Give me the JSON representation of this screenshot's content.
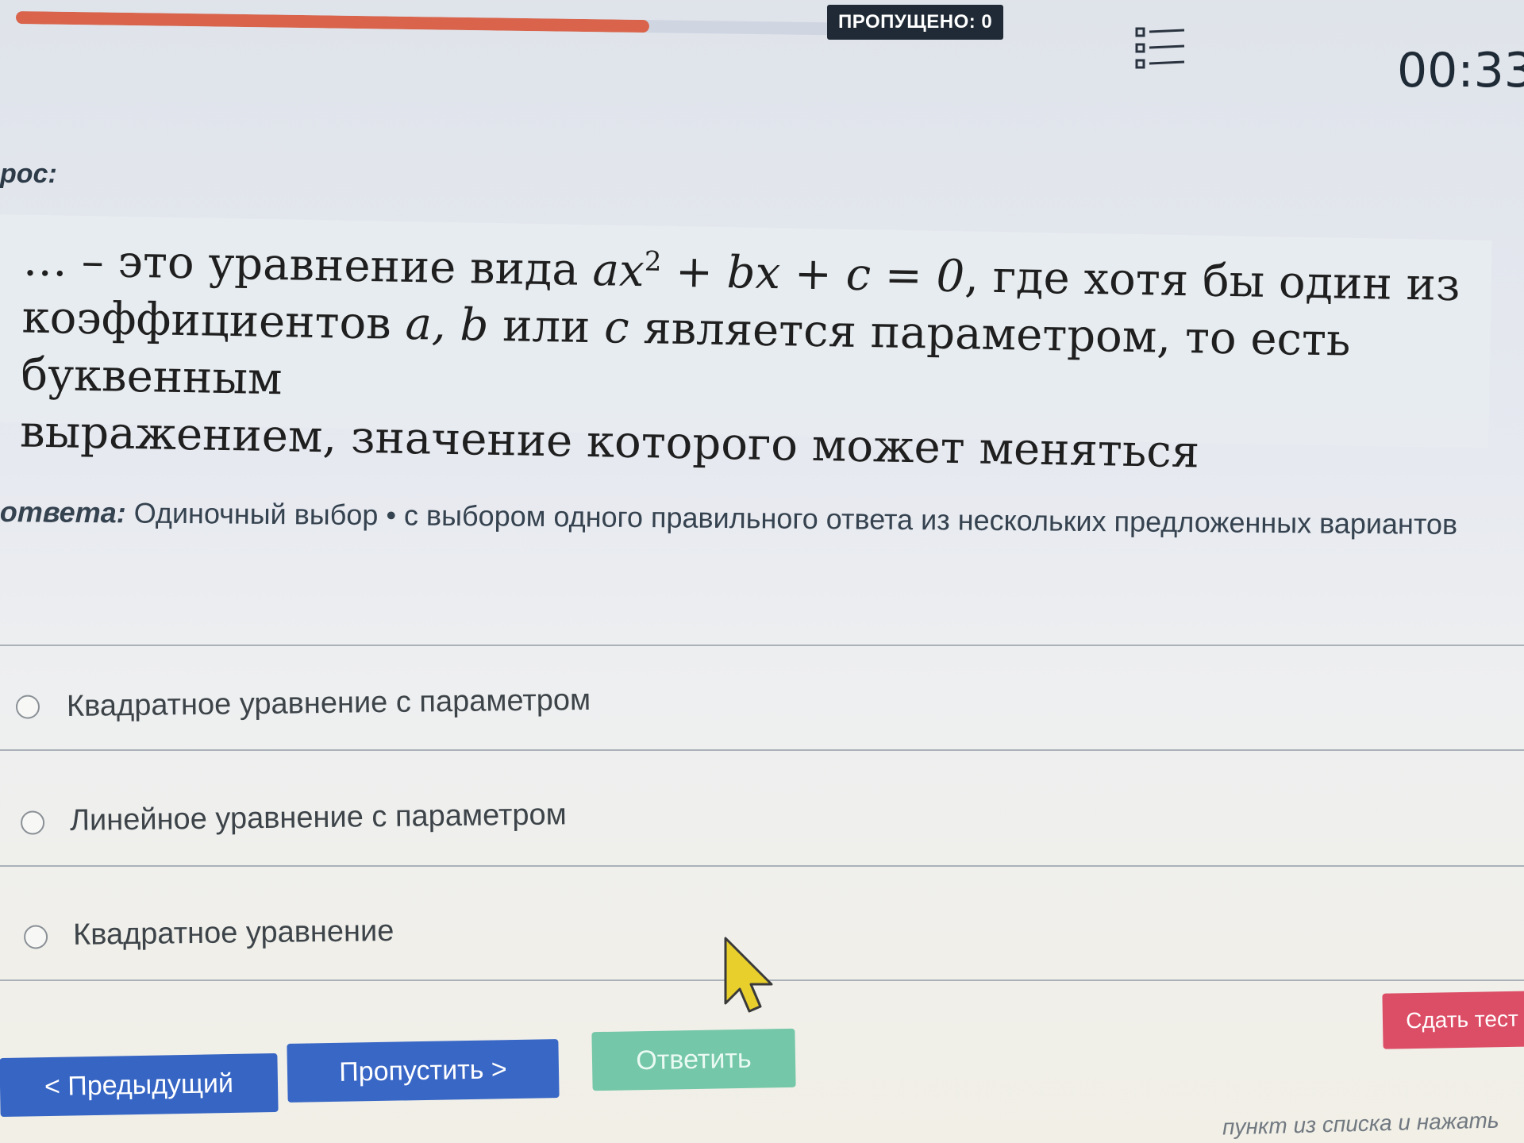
{
  "progress": {
    "fraction": 0.65
  },
  "header": {
    "skipped": "ПРОПУЩЕНО: 0",
    "timer": "00:33:"
  },
  "question": {
    "label": "рос:",
    "text": {
      "prefix": "… – это уравнение вида ",
      "formula_a": "ax",
      "formula_sup": "2",
      "formula_rest": " + bx + c = 0",
      "line1_end": ", где хотя бы один из",
      "line2_start": "коэффициентов ",
      "coeffs": "a, b",
      "line2_mid": " или ",
      "coeff_c": "c",
      "line2_end": " является параметром, то есть буквенным",
      "line3": "выражением, значение которого может меняться"
    }
  },
  "answer_type": {
    "label": "ответа:",
    "value": "Одиночный выбор • с выбором одного правильного ответа из нескольких предложенных вариантов"
  },
  "options": [
    {
      "label": "Квадратное уравнение с параметром"
    },
    {
      "label": "Линейное уравнение с параметром"
    },
    {
      "label": "Квадратное уравнение"
    }
  ],
  "buttons": {
    "prev": "< Предыдущий",
    "skip": "Пропустить >",
    "answer": "Ответить",
    "submit": "Сдать тест"
  },
  "footer_hint": "пункт из списка и нажать",
  "colors": {
    "progress": "#d9644b",
    "primary": "#3665c4",
    "answer": "#74c7a8",
    "submit": "#dc4d66"
  }
}
